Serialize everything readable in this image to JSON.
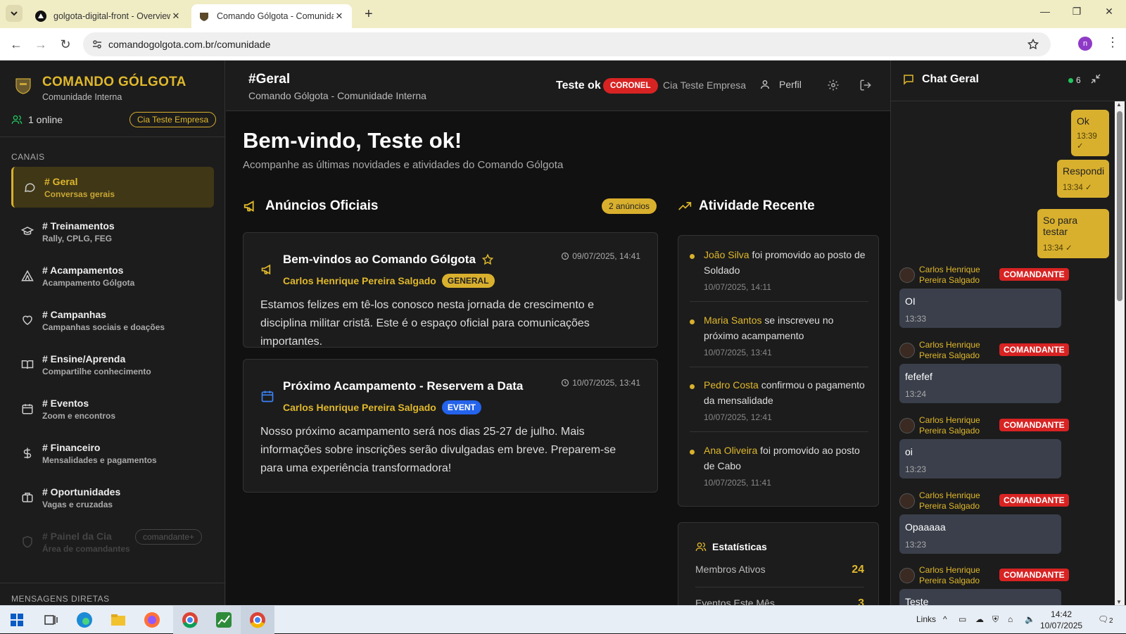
{
  "browser": {
    "tabs": [
      {
        "title": "golgota-digital-front - Overview",
        "icon": "vercel-icon"
      },
      {
        "title": "Comando Gólgota - Comunidade",
        "icon": "site-favicon"
      }
    ],
    "url": "comandogolgota.com.br/comunidade",
    "profile_initial": "n"
  },
  "sidebar": {
    "brand_title": "COMANDO GÓLGOTA",
    "brand_sub": "Comunidade Interna",
    "online": "1 online",
    "company": "Cia Teste Empresa",
    "channels_label": "CANAIS",
    "channels": [
      {
        "name": "# Geral",
        "desc": "Conversas gerais",
        "icon": "chat-bubble-icon"
      },
      {
        "name": "# Treinamentos",
        "desc": "Rally, CPLG, FEG",
        "icon": "graduation-cap-icon"
      },
      {
        "name": "# Acampamentos",
        "desc": "Acampamento Gólgota",
        "icon": "tent-icon"
      },
      {
        "name": "# Campanhas",
        "desc": "Campanhas sociais e doações",
        "icon": "heart-icon"
      },
      {
        "name": "# Ensine/Aprenda",
        "desc": "Compartilhe conhecimento",
        "icon": "book-icon"
      },
      {
        "name": "# Eventos",
        "desc": "Zoom e encontros",
        "icon": "calendar-icon"
      },
      {
        "name": "# Financeiro",
        "desc": "Mensalidades e pagamentos",
        "icon": "dollar-icon"
      },
      {
        "name": "# Oportunidades",
        "desc": "Vagas e cruzadas",
        "icon": "briefcase-icon"
      },
      {
        "name": "# Painel da Cia",
        "desc": "Área de comandantes",
        "icon": "shield-icon",
        "pill": "comandante+"
      }
    ],
    "dm_label": "MENSAGENS DIRETAS"
  },
  "header": {
    "title": "#Geral",
    "subtitle": "Comando Gólgota - Comunidade Interna",
    "user_name": "Teste ok",
    "rank": "CORONEL",
    "company": "Cia Teste Empresa",
    "profile_label": "Perfil"
  },
  "main": {
    "welcome": "Bem-vindo, Teste ok!",
    "welcome_sub": "Acompanhe as últimas novidades e atividades do Comando Gólgota",
    "announcements_title": "Anúncios Oficiais",
    "announcements_count": "2 anúncios",
    "announcements": [
      {
        "title": "Bem-vindos ao Comando Gólgota",
        "date": "09/07/2025, 14:41",
        "author": "Carlos Henrique Pereira Salgado",
        "tag": "GENERAL",
        "body": "Estamos felizes em tê-los conosco nesta jornada de crescimento e disciplina militar cristã. Este é o espaço oficial para comunicações importantes."
      },
      {
        "title": "Próximo Acampamento - Reservem a Data",
        "date": "10/07/2025, 13:41",
        "author": "Carlos Henrique Pereira Salgado",
        "tag": "EVENT",
        "body": "Nosso próximo acampamento será nos dias 25-27 de julho. Mais informações sobre inscrições serão divulgadas em breve. Preparem-se para uma experiência transformadora!"
      }
    ],
    "activity_title": "Atividade Recente",
    "activity": [
      {
        "name": "João Silva",
        "text": " foi promovido ao posto de Soldado",
        "time": "10/07/2025, 14:11"
      },
      {
        "name": "Maria Santos",
        "text": " se inscreveu no próximo acampamento",
        "time": "10/07/2025, 13:41"
      },
      {
        "name": "Pedro Costa",
        "text": " confirmou o pagamento da mensalidade",
        "time": "10/07/2025, 12:41"
      },
      {
        "name": "Ana Oliveira",
        "text": " foi promovido ao posto de Cabo",
        "time": "10/07/2025, 11:41"
      }
    ],
    "stats_title": "Estatísticas",
    "stats": [
      {
        "label": "Membros Ativos",
        "value": "24"
      },
      {
        "label": "Eventos Este Mês",
        "value": "3"
      }
    ]
  },
  "chat": {
    "title": "Chat Geral",
    "online_count": "6",
    "my_messages": [
      {
        "text": "Ok",
        "time": "13:39 ✓"
      },
      {
        "text": "Respondi",
        "time": "13:34 ✓"
      },
      {
        "text": "So para testar",
        "time": "13:34 ✓"
      }
    ],
    "messages": [
      {
        "author": "Carlos Henrique Pereira Salgado",
        "role": "COMANDANTE",
        "text": "OI",
        "time": "13:33"
      },
      {
        "author": "Carlos Henrique Pereira Salgado",
        "role": "COMANDANTE",
        "text": "fefefef",
        "time": "13:24"
      },
      {
        "author": "Carlos Henrique Pereira Salgado",
        "role": "COMANDANTE",
        "text": "oi",
        "time": "13:23"
      },
      {
        "author": "Carlos Henrique Pereira Salgado",
        "role": "COMANDANTE",
        "text": "Opaaaaa",
        "time": "13:23"
      },
      {
        "author": "Carlos Henrique Pereira Salgado",
        "role": "COMANDANTE",
        "text": "Teste",
        "time": ""
      }
    ]
  },
  "taskbar": {
    "links_label": "Links",
    "time": "14:42",
    "date": "10/07/2025",
    "notif_count": "2"
  }
}
